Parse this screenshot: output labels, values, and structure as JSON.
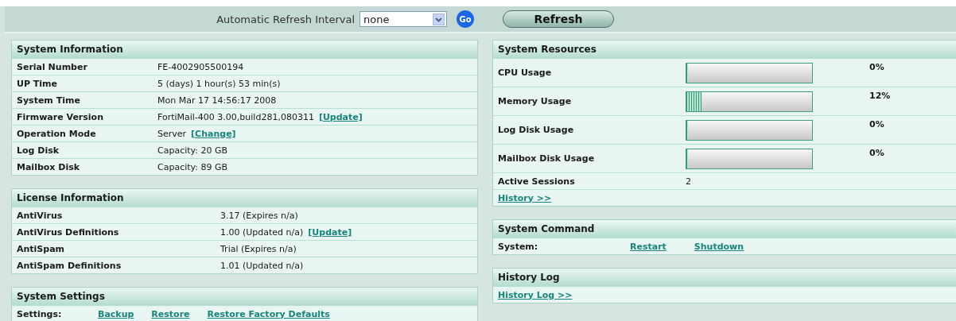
{
  "toolbar": {
    "refresh_label": "Automatic Refresh Interval",
    "refresh_select": "none",
    "go_button": "Go",
    "refresh_button": "Refresh"
  },
  "system_information": {
    "title": "System Information",
    "rows": [
      {
        "label": "Serial Number",
        "value": "FE-4002905500194"
      },
      {
        "label": "UP Time",
        "value": "5 (days) 1 hour(s) 53 min(s)"
      },
      {
        "label": "System Time",
        "value": "Mon Mar 17 14:56:17 2008"
      },
      {
        "label": "Firmware Version",
        "value": "FortiMail-400 3.00,build281,080311",
        "link": "[Update]"
      },
      {
        "label": "Operation Mode",
        "value": "Server",
        "link": "[Change]"
      },
      {
        "label": "Log Disk",
        "value": "Capacity: 20 GB"
      },
      {
        "label": "Mailbox Disk",
        "value": "Capacity: 89 GB"
      }
    ]
  },
  "license_information": {
    "title": "License Information",
    "rows": [
      {
        "label": "AntiVirus",
        "value": "3.17 (Expires n/a)"
      },
      {
        "label": "AntiVirus Definitions",
        "value": "1.00 (Updated n/a)",
        "link": "[Update]"
      },
      {
        "label": "AntiSpam",
        "value": "Trial (Expires n/a)"
      },
      {
        "label": "AntiSpam Definitions",
        "value": "1.01 (Updated n/a)"
      }
    ]
  },
  "system_settings": {
    "title": "System Settings",
    "label": "Settings:",
    "links": [
      "Backup",
      "Restore",
      "Restore Factory Defaults"
    ]
  },
  "system_resources": {
    "title": "System Resources",
    "rows": [
      {
        "kind": "meter",
        "label": "CPU Usage",
        "level": 0,
        "reading": "0%"
      },
      {
        "kind": "meter",
        "label": "Memory Usage",
        "level": 0.12,
        "reading": "12%"
      },
      {
        "kind": "meter",
        "label": "Log Disk Usage",
        "level": 0,
        "reading": "0%"
      },
      {
        "kind": "meter",
        "label": "Mailbox Disk Usage",
        "level": 0,
        "reading": "0%"
      },
      {
        "kind": "text",
        "label": "Active Sessions",
        "value": "2"
      }
    ],
    "link": "History >>"
  },
  "system_command": {
    "title": "System Command",
    "label": "System:",
    "links": [
      "Restart",
      "Shutdown"
    ]
  },
  "history_log": {
    "title": "History Log",
    "link": "History Log >>"
  }
}
